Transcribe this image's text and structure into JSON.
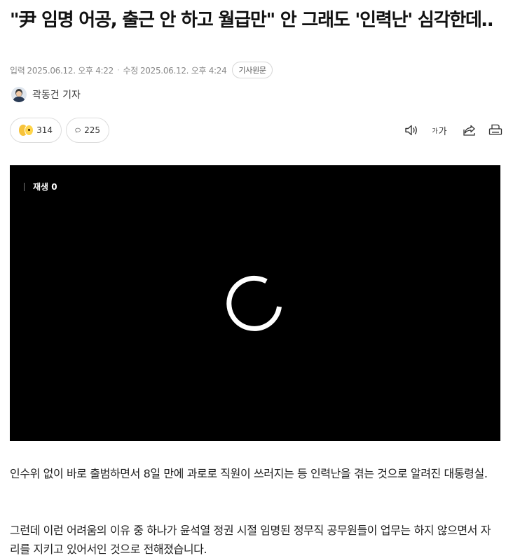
{
  "article": {
    "headline": "\"尹 임명 어공, 출근 안 하고 월급만\" 안 그래도 '인력난' 심각한데‥",
    "input_label": "입력",
    "input_time": "2025.06.12. 오후 4:22",
    "separator": "·",
    "modified_label": "수정",
    "modified_time": "2025.06.12. 오후 4:24",
    "origin_button": "기사원문",
    "reporter": "곽동건 기자"
  },
  "actions": {
    "reaction_count": "314",
    "comment_count": "225",
    "font_small": "가",
    "font_large": "가"
  },
  "video": {
    "status_text": "재생 0"
  },
  "body": {
    "paragraph1": "인수위 없이 바로 출범하면서 8일 만에 과로로 직원이 쓰러지는 등 인력난을 겪는 것으로 알려진 대통령실.",
    "paragraph2": "그런데 이런 어려움의 이유 중 하나가 윤석열 정권 시절 임명된 정무직 공무원들이 업무는 하지 않으면서 자리를 지키고 있어서인 것으로 전해졌습니다."
  },
  "icons": {
    "speaker": "speaker-icon",
    "font_size": "font-size-icon",
    "share": "share-icon",
    "print": "print-icon",
    "comment": "comment-bubble-icon",
    "spinner": "loading-spinner-icon"
  }
}
